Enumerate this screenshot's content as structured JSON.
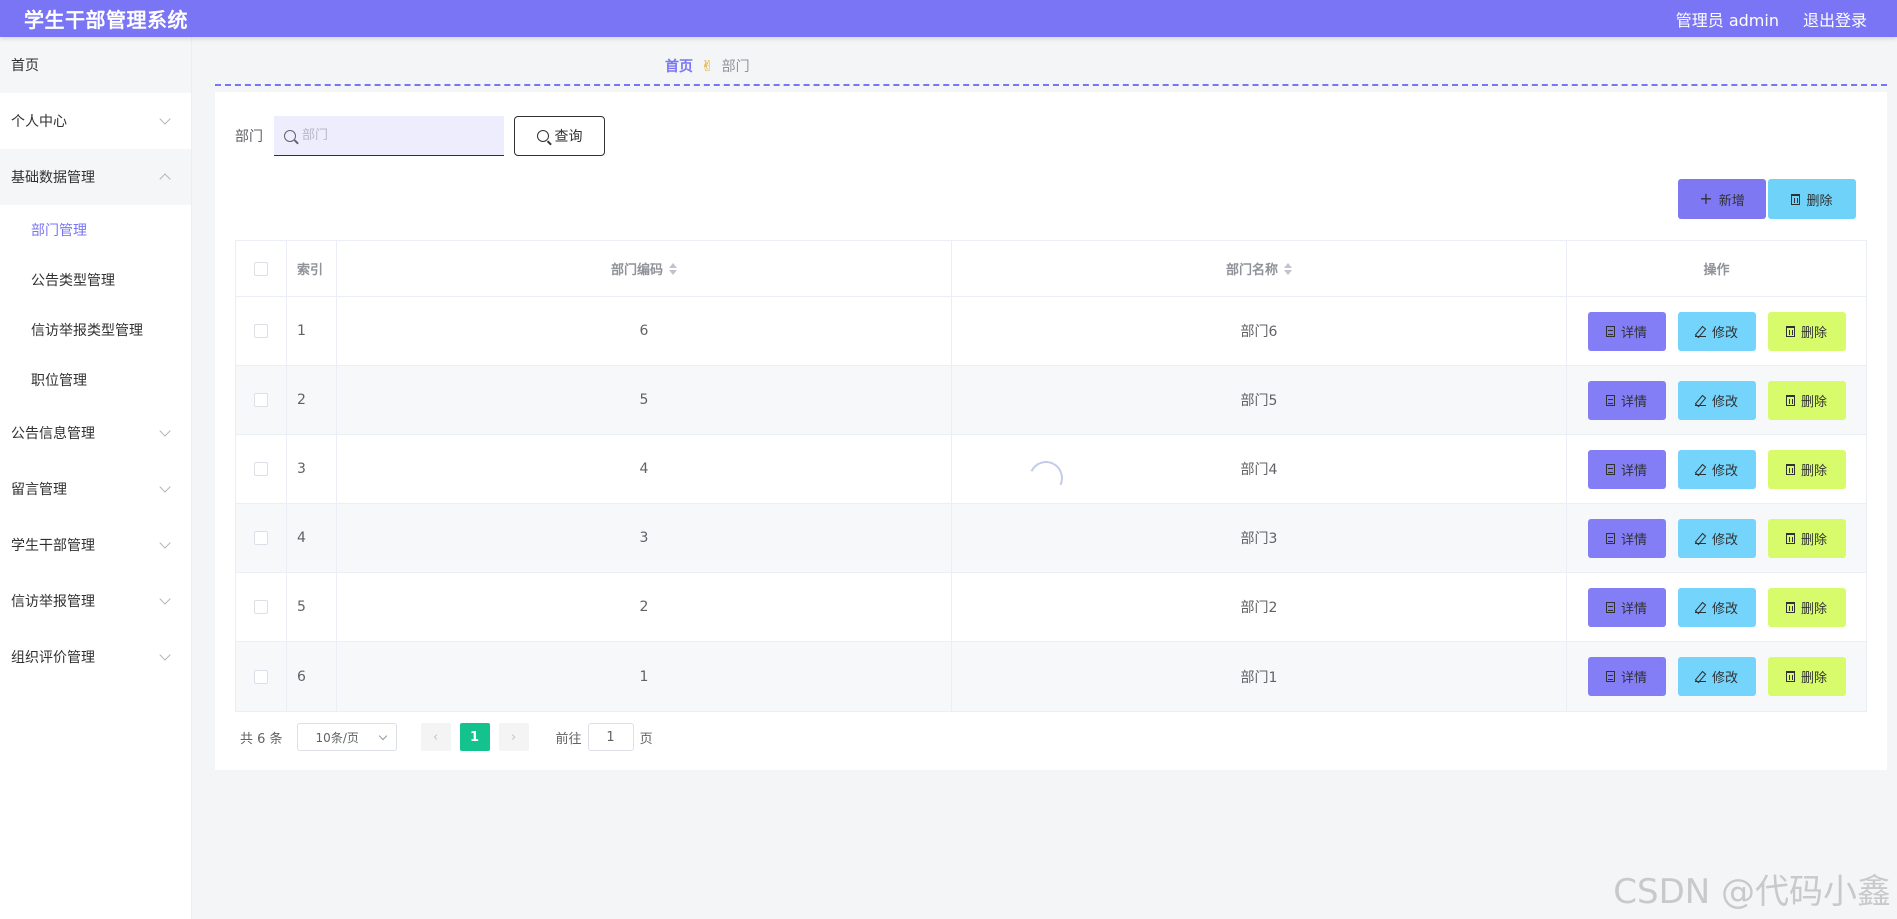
{
  "app": {
    "title": "学生干部管理系统",
    "user_label": "管理员 admin",
    "logout_label": "退出登录"
  },
  "sidebar": {
    "home": "首页",
    "items": [
      {
        "label": "个人中心"
      },
      {
        "label": "基础数据管理",
        "children": [
          "部门管理",
          "公告类型管理",
          "信访举报类型管理",
          "职位管理"
        ]
      },
      {
        "label": "公告信息管理"
      },
      {
        "label": "留言管理"
      },
      {
        "label": "学生干部管理"
      },
      {
        "label": "信访举报管理"
      },
      {
        "label": "组织评价管理"
      }
    ]
  },
  "breadcrumb": {
    "home": "首页",
    "separator": "✌",
    "current": "部门"
  },
  "search": {
    "label": "部门",
    "placeholder": "部门",
    "button_label": "查询"
  },
  "actions": {
    "add_label": "新增",
    "delete_label": "删除"
  },
  "table": {
    "headers": {
      "index": "索引",
      "code": "部门编码",
      "name": "部门名称",
      "ops": "操作"
    },
    "rows": [
      {
        "index": "1",
        "code": "6",
        "name": "部门6"
      },
      {
        "index": "2",
        "code": "5",
        "name": "部门5"
      },
      {
        "index": "3",
        "code": "4",
        "name": "部门4"
      },
      {
        "index": "4",
        "code": "3",
        "name": "部门3"
      },
      {
        "index": "5",
        "code": "2",
        "name": "部门2"
      },
      {
        "index": "6",
        "code": "1",
        "name": "部门1"
      }
    ],
    "row_actions": {
      "detail": "详情",
      "edit": "修改",
      "delete": "删除"
    }
  },
  "pagination": {
    "total": "共 6 条",
    "page_size": "10条/页",
    "current_page": "1",
    "goto_label": "前往",
    "goto_value": "1",
    "page_suffix": "页"
  },
  "watermark": "CSDN @代码小鑫",
  "colors": {
    "primary": "#7a75f5",
    "detail": "#837ef6",
    "edit": "#74d4fb",
    "delete": "#d8fb6c",
    "page_active": "#13c28d"
  }
}
